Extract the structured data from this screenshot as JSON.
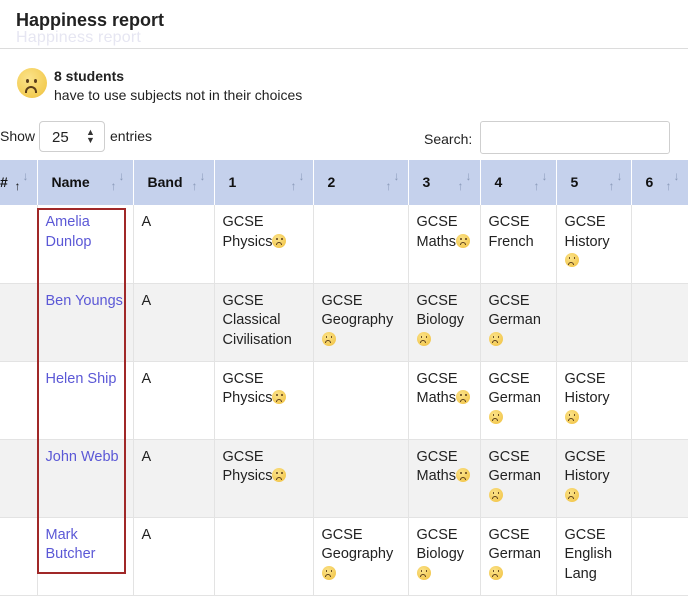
{
  "header": {
    "title": "Happiness report",
    "title_ghost": "Happiness report"
  },
  "summary": {
    "icon": "sad-face-icon",
    "count": "8 students",
    "description": "have to use subjects not in their choices"
  },
  "controls": {
    "show_label": "Show",
    "length_value": "25",
    "entries_label": "entries",
    "search_label": "Search:",
    "search_value": ""
  },
  "table": {
    "columns": [
      {
        "key": "hash",
        "label": "#"
      },
      {
        "key": "name",
        "label": "Name"
      },
      {
        "key": "band",
        "label": "Band"
      },
      {
        "key": "c1",
        "label": "1"
      },
      {
        "key": "c2",
        "label": "2"
      },
      {
        "key": "c3",
        "label": "3"
      },
      {
        "key": "c4",
        "label": "4"
      },
      {
        "key": "c5",
        "label": "5"
      },
      {
        "key": "c6",
        "label": "6"
      }
    ],
    "rows": [
      {
        "name": "Amelia Dunlop",
        "band": "A",
        "cells": [
          {
            "text": "GCSE\nPhysics",
            "sad": true
          },
          {
            "text": "",
            "sad": false
          },
          {
            "text": "GCSE\nMaths",
            "sad": true
          },
          {
            "text": "GCSE\nFrench",
            "sad": false
          },
          {
            "text": "GCSE\nHistory",
            "sad": true
          },
          {
            "text": "",
            "sad": false
          }
        ]
      },
      {
        "name": "Ben Youngs",
        "band": "A",
        "cells": [
          {
            "text": "GCSE\nClassical\nCivilisation",
            "sad": false
          },
          {
            "text": "GCSE\nGeography",
            "sad": true
          },
          {
            "text": "GCSE\nBiology",
            "sad": true
          },
          {
            "text": "GCSE\nGerman",
            "sad": true
          },
          {
            "text": "",
            "sad": false
          },
          {
            "text": "",
            "sad": false
          }
        ]
      },
      {
        "name": "Helen Ship",
        "band": "A",
        "cells": [
          {
            "text": "GCSE\nPhysics",
            "sad": true
          },
          {
            "text": "",
            "sad": false
          },
          {
            "text": "GCSE\nMaths",
            "sad": true
          },
          {
            "text": "GCSE\nGerman",
            "sad": true
          },
          {
            "text": "GCSE\nHistory",
            "sad": true
          },
          {
            "text": "",
            "sad": false
          }
        ]
      },
      {
        "name": "John Webb",
        "band": "A",
        "cells": [
          {
            "text": "GCSE\nPhysics",
            "sad": true
          },
          {
            "text": "",
            "sad": false
          },
          {
            "text": "GCSE\nMaths",
            "sad": true
          },
          {
            "text": "GCSE\nGerman",
            "sad": true
          },
          {
            "text": "GCSE\nHistory",
            "sad": true
          },
          {
            "text": "",
            "sad": false
          }
        ]
      },
      {
        "name": "Mark Butcher",
        "band": "A",
        "cells": [
          {
            "text": "",
            "sad": false
          },
          {
            "text": "GCSE\nGeography",
            "sad": true
          },
          {
            "text": "GCSE\nBiology",
            "sad": true
          },
          {
            "text": "GCSE\nGerman",
            "sad": true
          },
          {
            "text": "GCSE\nEnglish\nLang",
            "sad": false
          },
          {
            "text": "",
            "sad": false
          }
        ]
      }
    ]
  },
  "colors": {
    "header_bg": "#c5d1ec",
    "link": "#5b58d6",
    "highlight": "#a02828",
    "row_alt": "#f2f2f2"
  }
}
